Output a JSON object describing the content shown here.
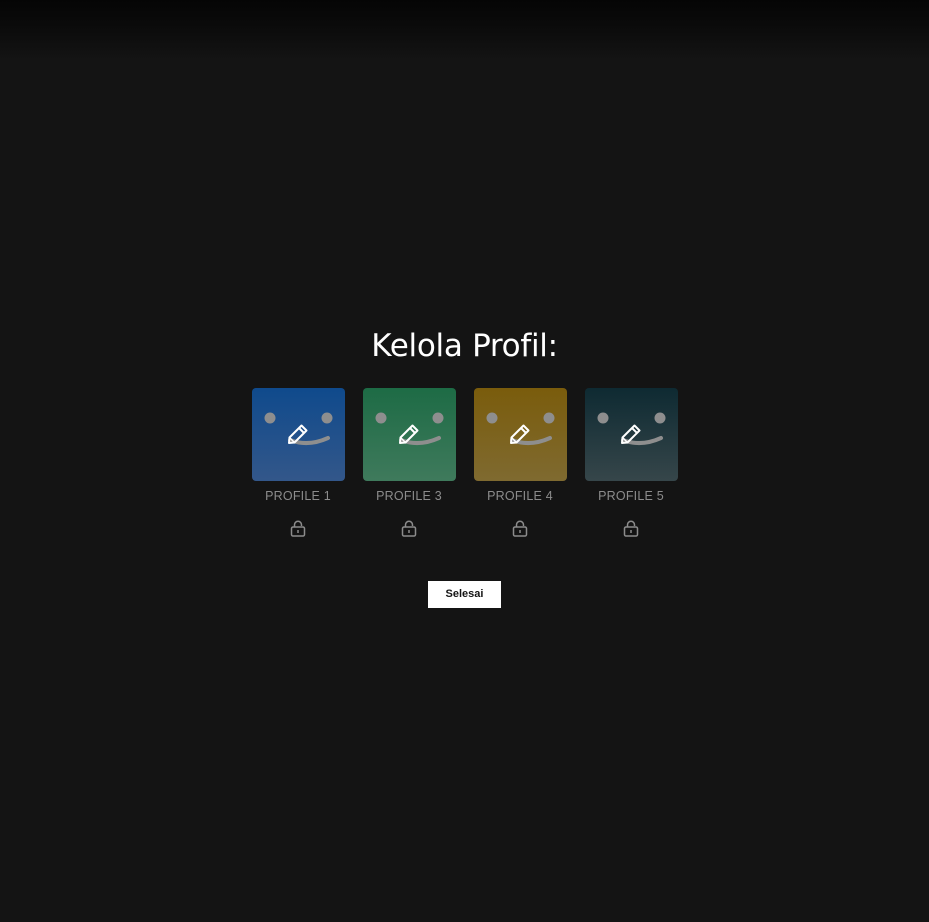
{
  "page": {
    "title": "Kelola Profil:",
    "done_label": "Selesai"
  },
  "profiles": [
    {
      "name": "PROFILE 1",
      "color_top": "#0f4a8c",
      "color_bottom": "#33578a",
      "icon": "edit-pencil-icon",
      "lock_icon": "lock-icon"
    },
    {
      "name": "PROFILE 3",
      "color_top": "#1d6b45",
      "color_bottom": "#3f7a5c",
      "icon": "edit-pencil-icon",
      "lock_icon": "lock-icon"
    },
    {
      "name": "PROFILE 4",
      "color_top": "#7a5c0c",
      "color_bottom": "#7f6a30",
      "icon": "edit-pencil-icon",
      "lock_icon": "lock-icon"
    },
    {
      "name": "PROFILE 5",
      "color_top": "#0e2a32",
      "color_bottom": "#36464a",
      "icon": "edit-pencil-icon",
      "lock_icon": "lock-icon"
    }
  ]
}
